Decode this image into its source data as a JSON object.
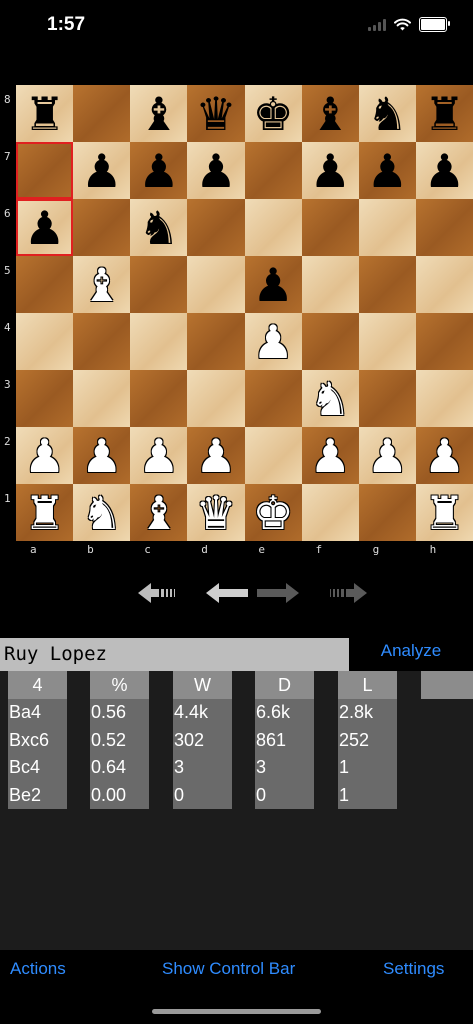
{
  "status_bar": {
    "time": "1:57"
  },
  "board": {
    "rank_labels": [
      "8",
      "7",
      "6",
      "5",
      "4",
      "3",
      "2",
      "1"
    ],
    "file_labels": [
      "a",
      "b",
      "c",
      "d",
      "e",
      "f",
      "g",
      "h"
    ],
    "highlighted_squares": [
      "a7",
      "a6"
    ],
    "position": [
      [
        "bR",
        "",
        "bB",
        "bQ",
        "bK",
        "bB",
        "bN",
        "bR"
      ],
      [
        "",
        "bP",
        "bP",
        "bP",
        "",
        "bP",
        "bP",
        "bP"
      ],
      [
        "bP",
        "",
        "bN",
        "",
        "",
        "",
        "",
        ""
      ],
      [
        "",
        "wB",
        "",
        "",
        "bP",
        "",
        "",
        ""
      ],
      [
        "",
        "",
        "",
        "",
        "wP",
        "",
        "",
        ""
      ],
      [
        "",
        "",
        "",
        "",
        "",
        "wN",
        "",
        ""
      ],
      [
        "wP",
        "wP",
        "wP",
        "wP",
        "",
        "wP",
        "wP",
        "wP"
      ],
      [
        "wR",
        "wN",
        "wB",
        "wQ",
        "wK",
        "",
        "",
        "wR"
      ]
    ]
  },
  "navigation": {
    "buttons": [
      {
        "name": "first-move-button",
        "icon": "first-arrow-icon"
      },
      {
        "name": "previous-move-button",
        "icon": "left-arrow-icon"
      },
      {
        "name": "next-move-button",
        "icon": "right-arrow-icon"
      },
      {
        "name": "last-move-button",
        "icon": "last-arrow-icon"
      }
    ]
  },
  "opening": {
    "name": "Ruy Lopez",
    "analyze_label": "Analyze"
  },
  "stats": {
    "columns": [
      {
        "header": "4",
        "values": [
          "Ba4",
          "Bxc6",
          "Bc4",
          "Be2"
        ]
      },
      {
        "header": "%",
        "values": [
          "0.56",
          "0.52",
          "0.64",
          "0.00"
        ]
      },
      {
        "header": "W",
        "values": [
          "4.4k",
          "302",
          "3",
          "0"
        ]
      },
      {
        "header": "D",
        "values": [
          "6.6k",
          "861",
          "3",
          "0"
        ]
      },
      {
        "header": "L",
        "values": [
          "2.8k",
          "252",
          "1",
          "1"
        ]
      }
    ]
  },
  "toolbar": {
    "actions_label": "Actions",
    "control_bar_label": "Show Control Bar",
    "settings_label": "Settings"
  },
  "colors": {
    "accent": "#2f8cff",
    "highlight": "#e02020",
    "light_square": "#e8cc9e",
    "dark_square": "#a8652a"
  }
}
